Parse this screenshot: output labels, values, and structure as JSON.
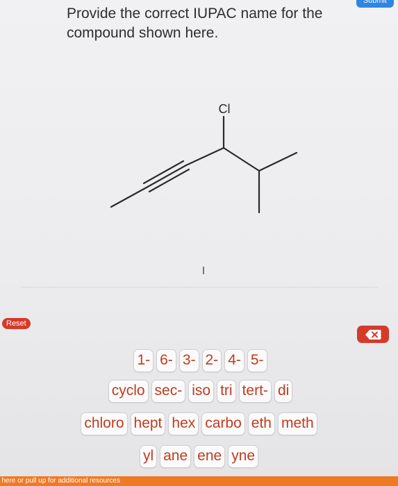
{
  "header": {
    "submit_label": "Submit"
  },
  "question": {
    "text": "Provide the correct IUPAC name for the compound shown here."
  },
  "molecule": {
    "substituent_label": "Cl"
  },
  "controls": {
    "reset_label": "Reset",
    "backspace_icon": "backspace-x-icon"
  },
  "tokens": {
    "row1": [
      "1-",
      "6-",
      "3-",
      "2-",
      "4-",
      "5-"
    ],
    "row2": [
      "cyclo",
      "sec-",
      "iso",
      "tri",
      "tert-",
      "di"
    ],
    "row3": [
      "chloro",
      "hept",
      "hex",
      "carbo",
      "eth",
      "meth"
    ],
    "row4": [
      "yl",
      "ane",
      "ene",
      "yne"
    ]
  },
  "footer": {
    "resources_text": "p here or pull up for additional resources"
  },
  "colors": {
    "token_text": "#c23a1f",
    "reset": "#d63a2a",
    "submit": "#2f86e0",
    "footer": "#ef7a24"
  }
}
